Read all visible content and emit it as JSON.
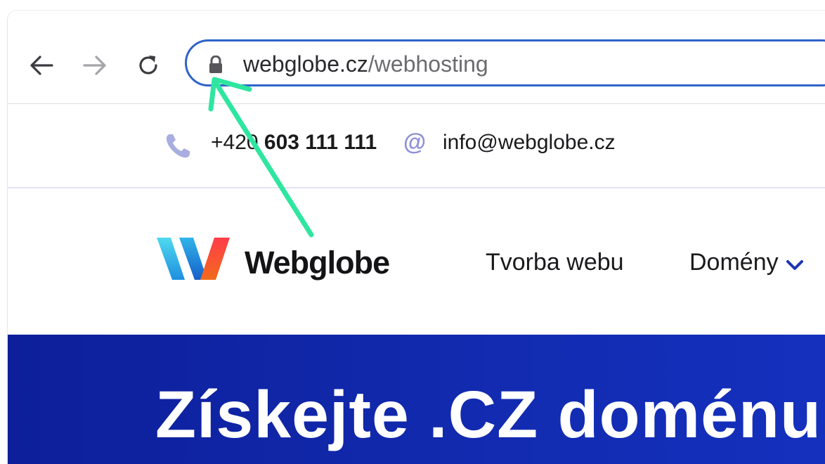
{
  "browser": {
    "url_domain": "webglobe.cz",
    "url_path": "/webhosting"
  },
  "contact": {
    "phone_prefix": "+420 ",
    "phone_number": "603 111 111",
    "at_symbol": "@",
    "email": "info@webglobe.cz"
  },
  "header": {
    "logo_text": "Webglobe",
    "nav": [
      {
        "label": "Tvorba webu"
      },
      {
        "label": "Domény"
      }
    ]
  },
  "hero": {
    "title": "Získejte .CZ doménu"
  },
  "colors": {
    "omnibox_border": "#2f63c8",
    "hero_background": "#122bb0",
    "annotation_arrow": "#2ee6a0",
    "accent_icon": "#8f8fd8"
  },
  "icons": [
    "back-arrow-icon",
    "forward-arrow-icon",
    "reload-icon",
    "lock-icon",
    "phone-icon",
    "at-icon",
    "chevron-down-icon",
    "webglobe-logo-icon"
  ]
}
